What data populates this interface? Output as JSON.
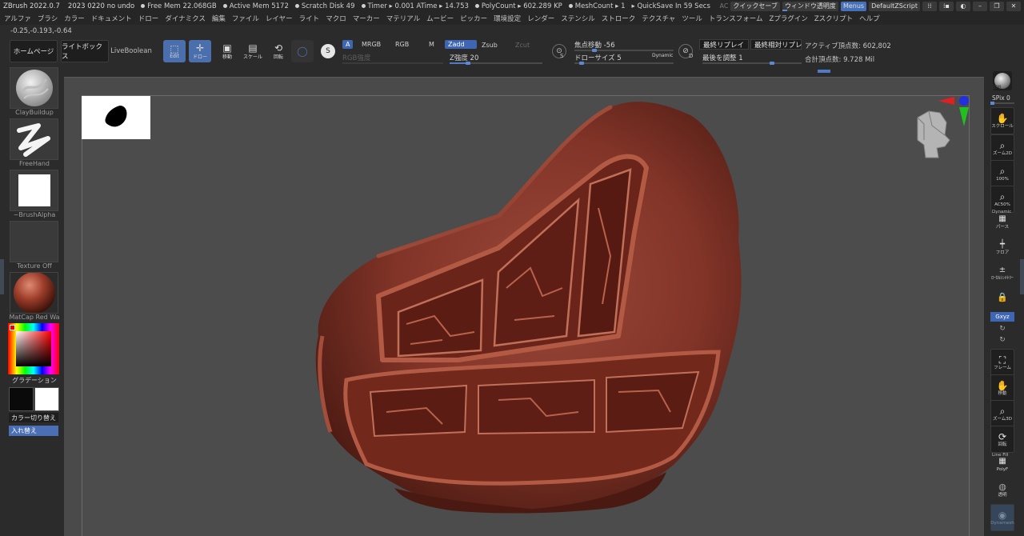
{
  "titlebar": {
    "app_title": "ZBrush 2022.0.7",
    "build": "2023 0220 no undo",
    "stats": [
      "Free Mem 22.068GB",
      "Active Mem 5172",
      "Scratch Disk 49",
      "Timer ▸ 0.001 ATime ▸ 14.753",
      "PolyCount ▸ 602.289 KP",
      "MeshCount ▸ 1",
      "▸ QuickSave In 59 Secs"
    ],
    "ac": "AC",
    "quicksave": "クイックセーブ",
    "window_transparency": "ウィンドウ透明度",
    "menus": "Menus",
    "default_zscript": "DefaultZScript"
  },
  "menubar": [
    "アルファ",
    "ブラシ",
    "カラー",
    "ドキュメント",
    "ドロー",
    "ダイナミクス",
    "編集",
    "ファイル",
    "レイヤー",
    "ライト",
    "マクロ",
    "マーカー",
    "マテリアル",
    "ムービー",
    "ピッカー",
    "環境設定",
    "レンダー",
    "ステンシル",
    "ストローク",
    "テクスチャ",
    "ツール",
    "トランスフォーム",
    "Zプラグイン",
    "Zスクリプト",
    "ヘルプ"
  ],
  "coords": "-0.25,-0.193,-0.64",
  "toolbar": {
    "home": "ホームページ",
    "lightbox": "ライトボックス",
    "liveboolean": "LiveBoolean",
    "edit": "Edit",
    "draw": "ドロー",
    "move": "移動",
    "scale": "スケール",
    "rotate": "回転",
    "a_chip": "A",
    "mrgb": "MRGB",
    "rgb": "RGB",
    "m": "M",
    "zadd": "Zadd",
    "zsub": "Zsub",
    "zcut": "Zcut",
    "rgb_intensity": "RGB強度",
    "z_intensity_label": "Z強度",
    "z_intensity_value": "20",
    "z_intensity_fraction": 0.2,
    "focal_label": "焦点移動",
    "focal_value": "-56",
    "draw_size_label": "ドローサイズ",
    "draw_size_value": "5",
    "dynamic": "Dynamic",
    "s_key": "S",
    "d_key": "D",
    "last_replay": "最終リプレイ",
    "last_rel_replay": "最終相対リプレ",
    "adjust_last_label": "最後を調整",
    "adjust_last_value": "1",
    "active_points": "アクティブ頂点数: 602,802",
    "total_points": "合計頂点数: 9.728 Mil"
  },
  "leftshelf": {
    "brush": "ClayBuildup",
    "stroke": "FreeHand",
    "alpha": "~BrushAlpha",
    "texture": "Texture Off",
    "material": "MatCap Red Wa",
    "gradient": "グラデーション",
    "switch_color": "カラー切り替え",
    "swap": "入れ替え"
  },
  "rightshelf": {
    "bpr": "BPR",
    "spix_label": "SPix",
    "spix_value": "0",
    "scroll": "スクロール",
    "zoom2d": "ズーム2D",
    "z100": "100%",
    "ac50": "AC50%",
    "dynamic": "Dynamic",
    "perspective": "パース",
    "floor": "フロア",
    "local_sym": "ﾛｰｶﾙｼﾝﾒﾄﾘｰ",
    "gxyz": "Gxyz",
    "frame": "フレーム",
    "move": "移動",
    "zoom3d": "ズーム3D",
    "rotate": "回転",
    "linefill": "Line Fill",
    "polyf": "PolyF",
    "transp": "透明",
    "dynamesh": "Dynamesh"
  },
  "colors": {
    "accent_blue": "#4670b8",
    "sculpt_red": "#8a3a30",
    "canvas_gray": "#4c4c4c"
  }
}
